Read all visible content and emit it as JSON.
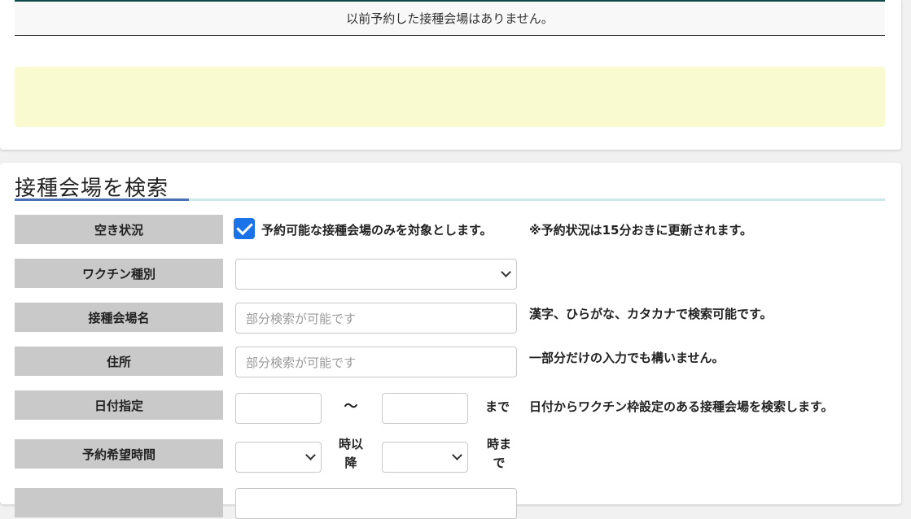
{
  "history": {
    "message": "以前予約した接種会場はありません。"
  },
  "search": {
    "title": "接種会場を検索",
    "availability": {
      "label": "空き状況",
      "checkbox_label": "予約可能な接種会場のみを対象とします。",
      "checked": true,
      "note": "※予約状況は15分おきに更新されます。"
    },
    "vaccine_type": {
      "label": "ワクチン種別",
      "value": ""
    },
    "venue_name": {
      "label": "接種会場名",
      "placeholder": "部分検索が可能です",
      "note": "漢字、ひらがな、カタカナで検索可能です。"
    },
    "address": {
      "label": "住所",
      "placeholder": "部分検索が可能です",
      "note": "一部分だけの入力でも構いません。"
    },
    "date": {
      "label": "日付指定",
      "separator": "～",
      "until": "まで",
      "note": "日付からワクチン枠設定のある接種会場を検索します。"
    },
    "time": {
      "label": "予約希望時間",
      "from_suffix_1": "時以",
      "from_suffix_2": "降",
      "until_1": "時ま",
      "until_2": "で"
    }
  },
  "colors": {
    "label_bg": "#c9c9c9",
    "notice_bg": "#fafad0",
    "accent": "#4a6fb5",
    "checkbox": "#1a73e8"
  }
}
